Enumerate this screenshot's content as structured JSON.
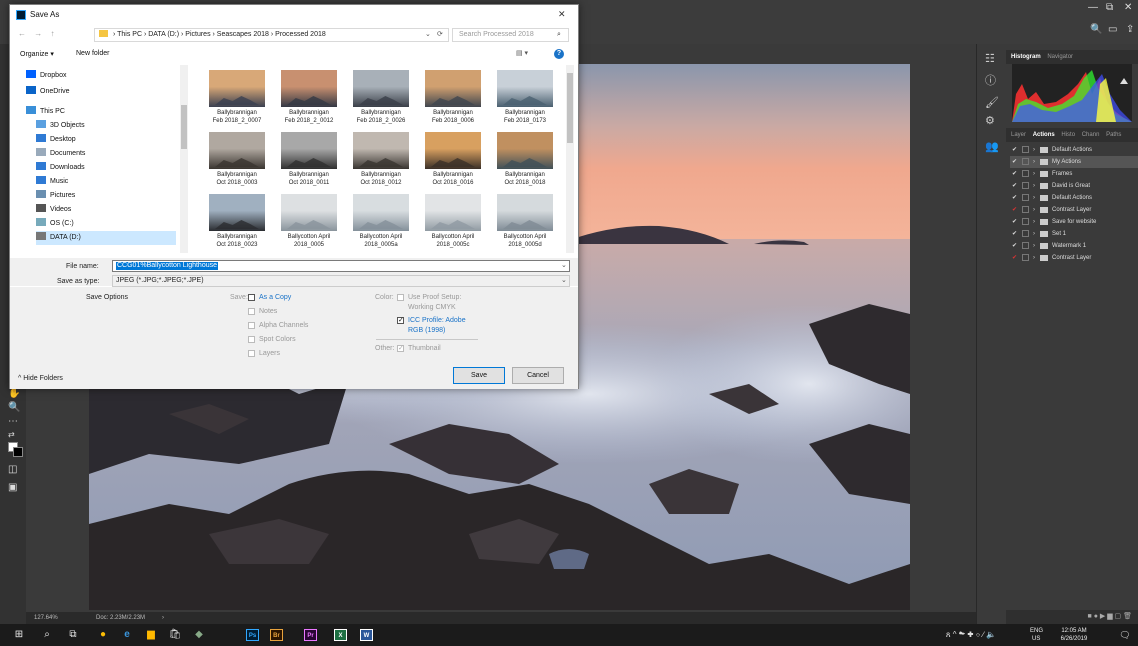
{
  "photoshop": {
    "window_controls": {
      "minimize": "—",
      "restore": "⧉",
      "close": "✕"
    },
    "top_icons": {
      "search": "🔍",
      "workspace": "▭",
      "share": "⇪"
    },
    "status": {
      "zoom": "127.64%",
      "doc": "Doc: 2.23M/2.23M",
      "arrow": "›"
    },
    "panels": {
      "top_tabs": [
        "Histogram",
        "Navigator"
      ],
      "action_tabs": [
        "Layer",
        "Actions",
        "Histo",
        "Chann",
        "Paths"
      ],
      "actions": [
        {
          "check": "✔",
          "name": "Default Actions",
          "selected": false,
          "red": false
        },
        {
          "check": "✔",
          "name": "My Actions",
          "selected": true,
          "red": false
        },
        {
          "check": "✔",
          "name": "Frames",
          "selected": false,
          "red": false
        },
        {
          "check": "✔",
          "name": "David is Great",
          "selected": false,
          "red": false
        },
        {
          "check": "✔",
          "name": "Default Actions",
          "selected": false,
          "red": false
        },
        {
          "check": "✔",
          "name": "Contrast Layer",
          "selected": false,
          "red": true
        },
        {
          "check": "✔",
          "name": "Save for website",
          "selected": false,
          "red": false
        },
        {
          "check": "✔",
          "name": "Set 1",
          "selected": false,
          "red": false
        },
        {
          "check": "✔",
          "name": "Watermark 1",
          "selected": false,
          "red": false
        },
        {
          "check": "✔",
          "name": "Contrast Layer",
          "selected": false,
          "red": true
        }
      ],
      "action_footer": "■ ● ▶ ▆ ▢ 🗑"
    }
  },
  "dialog": {
    "title": "Save As",
    "close": "✕",
    "nav_arrows": "← → ↑",
    "breadcrumb": "› This PC › DATA (D:) › Pictures › Seascapes 2018 › Processed 2018",
    "refresh": "⟳",
    "dropdown": "⌄",
    "search_placeholder": "Search Processed 2018",
    "search_icon": "⌕",
    "organize": "Organize ▾",
    "new_folder": "New folder",
    "view_icon": "▤ ▾",
    "help_icon": "?",
    "nav_items": [
      {
        "label": "Dropbox",
        "color": "#0061fe"
      },
      {
        "label": "OneDrive",
        "color": "#0a64c8"
      },
      {
        "label": "This PC",
        "color": "#3a8fd8"
      },
      {
        "label": "3D Objects",
        "color": "#5aa0e0"
      },
      {
        "label": "Desktop",
        "color": "#2f7ad4"
      },
      {
        "label": "Documents",
        "color": "#9ab"
      },
      {
        "label": "Downloads",
        "color": "#2f7ad4"
      },
      {
        "label": "Music",
        "color": "#2f7ad4"
      },
      {
        "label": "Pictures",
        "color": "#6a8fb0"
      },
      {
        "label": "Videos",
        "color": "#555"
      },
      {
        "label": "OS (C:)",
        "color": "#7ab"
      },
      {
        "label": "DATA (D:)",
        "color": "#777"
      }
    ],
    "files": [
      {
        "l1": "Ballybrannigan",
        "l2": "Feb 2018_2_0007",
        "c1": "#d8a878",
        "c2": "#3a4050"
      },
      {
        "l1": "Ballybrannigan",
        "l2": "Feb 2018_2_0012",
        "c1": "#c89070",
        "c2": "#333844"
      },
      {
        "l1": "Ballybrannigan",
        "l2": "Feb 2018_2_0026",
        "c1": "#a8b0b8",
        "c2": "#3a3f48"
      },
      {
        "l1": "Ballybrannigan",
        "l2": "Feb 2018_0006",
        "c1": "#d0a070",
        "c2": "#40464f"
      },
      {
        "l1": "Ballybrannigan",
        "l2": "Feb 2018_0173",
        "c1": "#c8d0d8",
        "c2": "#4a6070"
      },
      {
        "l1": "Ballybrannigan",
        "l2": "Oct 2018_0003",
        "c1": "#b0a8a0",
        "c2": "#3a3530"
      },
      {
        "l1": "Ballybrannigan",
        "l2": "Oct 2018_0011",
        "c1": "#a8a8a8",
        "c2": "#303030"
      },
      {
        "l1": "Ballybrannigan",
        "l2": "Oct 2018_0012",
        "c1": "#c0b8b0",
        "c2": "#383430"
      },
      {
        "l1": "Ballybrannigan",
        "l2": "Oct 2018_0016",
        "c1": "#d8a060",
        "c2": "#3a3028"
      },
      {
        "l1": "Ballybrannigan",
        "l2": "Oct 2018_0018",
        "c1": "#c09060",
        "c2": "#405058"
      },
      {
        "l1": "Ballybrannigan",
        "l2": "Oct 2018_0023",
        "c1": "#a0b0c0",
        "c2": "#2a2c30"
      },
      {
        "l1": "Ballycotton April",
        "l2": "2018_0005",
        "c1": "#dde0e2",
        "c2": "#8a949c"
      },
      {
        "l1": "Ballycotton April",
        "l2": "2018_0005a",
        "c1": "#d8dde0",
        "c2": "#84909a"
      },
      {
        "l1": "Ballycotton April",
        "l2": "2018_0005c",
        "c1": "#e2e4e6",
        "c2": "#909aa2"
      },
      {
        "l1": "Ballycotton April",
        "l2": "2018_0005d",
        "c1": "#d5dadd",
        "c2": "#7f8b95"
      }
    ],
    "file_name_label": "File name:",
    "file_name_value": "CCG01%Ballycotton Lighthouse",
    "save_type_label": "Save as type:",
    "save_type_value": "JPEG (*.JPG;*.JPEG;*.JPE)",
    "save_options": "Save Options",
    "save_label": "Save:",
    "as_copy": "As a Copy",
    "notes": "Notes",
    "alpha": "Alpha Channels",
    "spot": "Spot Colors",
    "layers": "Layers",
    "color_label": "Color:",
    "use_proof": "Use Proof Setup:",
    "working_cmyk": "Working CMYK",
    "icc": "ICC Profile: Adobe",
    "icc2": "RGB (1998)",
    "other_label": "Other:",
    "thumbnail": "Thumbnail",
    "check_mark": "✓",
    "hide_folders": "^ Hide Folders",
    "save_button": "Save",
    "cancel_button": "Cancel"
  },
  "taskbar": {
    "start": "⊞",
    "search": "⌕",
    "taskview": "⧉",
    "apps": [
      {
        "label": "Ps",
        "bg": "#001d34",
        "fg": "#31a8ff"
      },
      {
        "label": "Br",
        "bg": "#2b1400",
        "fg": "#e8a33d"
      },
      {
        "label": "Pr",
        "bg": "#2a0634",
        "fg": "#ea77ff"
      },
      {
        "label": "X",
        "bg": "#1d6f42",
        "fg": "#ffffff"
      },
      {
        "label": "W",
        "bg": "#2b579a",
        "fg": "#ffffff"
      }
    ],
    "tray_icons": "ጸ  ^  ☁  ✚  ⌔  ∕  🔈",
    "lang1": "ENG",
    "lang2": "US",
    "time": "12:05 AM",
    "date": "6/26/2019",
    "notify": "🗨"
  }
}
